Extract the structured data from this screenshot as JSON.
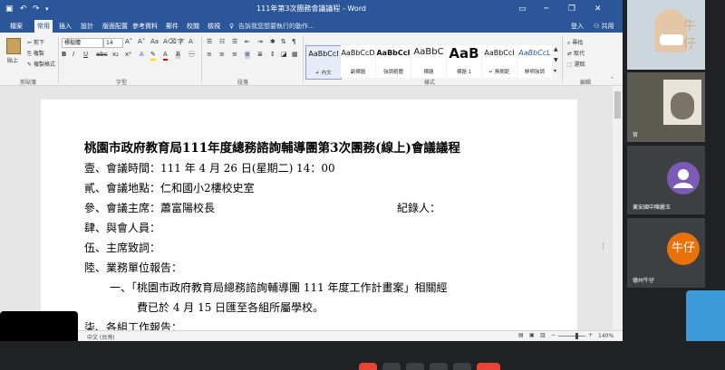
{
  "word": {
    "title": "111年第3次團務會議議程 - Word",
    "tabs": [
      "檔案",
      "常用",
      "插入",
      "設計",
      "版面配置",
      "參考資料",
      "郵件",
      "校閱",
      "檢視"
    ],
    "tell_me": "告訴我您想要執行的動作...",
    "sign_in": "登入",
    "share": "共用",
    "clipboard": {
      "paste": "貼上",
      "cut": "剪下",
      "copy": "複製",
      "format_painter": "複製格式",
      "label": "剪貼簿"
    },
    "font": {
      "name": "標楷體",
      "size": "14",
      "label": "字型"
    },
    "paragraph_label": "段落",
    "styles_label": "樣式",
    "styles": [
      {
        "preview": "AaBbCcI",
        "name": "↵ 內文"
      },
      {
        "preview": "AaBbCcD",
        "name": "副標題"
      },
      {
        "preview": "AaBbCcI",
        "name": "強調粗體"
      },
      {
        "preview": "AaBbC",
        "name": "標題"
      },
      {
        "preview": "AaB",
        "name": "標題 1"
      },
      {
        "preview": "AaBbCcI",
        "name": "↵ 無間距"
      },
      {
        "preview": "AaBbCcL",
        "name": "鮮明強調"
      }
    ],
    "editing": {
      "find": "尋找",
      "replace": "取代",
      "select": "選取",
      "label": "編輯"
    }
  },
  "document": {
    "lines": [
      "桃園市政府教育局111年度總務諮詢輔導團第3次團務(線上)會議議程",
      "壹、會議時間：111 年 4 月 26 日(星期二) 14：00",
      "貳、會議地點：仁和國小2樓校史室",
      "參、會議主席：蕭富陽校長",
      "紀錄人：",
      "肆、與會人員：",
      "伍、主席致詞：",
      "陸、業務單位報告：",
      "一、「桃園市政府教育局總務諮詢輔導團 111 年度工作計畫案」相關經",
      "費已於 4 月 15 日匯至各組所屬學校。",
      "柒、各組工作報告："
    ]
  },
  "status": {
    "language": "中文 (台灣)",
    "zoom": "140%"
  },
  "participants": [
    {
      "name": "",
      "avatar_text": ""
    },
    {
      "name": "官",
      "avatar_text": ""
    },
    {
      "name": "東安國中陳麗玉",
      "avatar_text": "",
      "avatar_color": "#7b5bb5"
    },
    {
      "name": "德州牛仔",
      "avatar_text": "牛仔",
      "avatar_color": "#e8710a"
    }
  ],
  "colors": {
    "word_blue": "#2b579a",
    "meet_bg": "#202124",
    "tile_bg": "#3c4043",
    "end_call": "#ea4335"
  }
}
